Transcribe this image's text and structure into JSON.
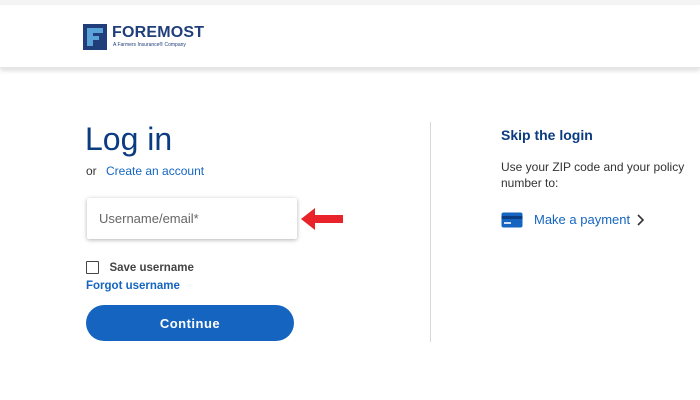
{
  "brand": {
    "name": "FOREMOST",
    "tagline": "A Farmers Insurance® Company",
    "logo_icon": "foremost-f-logo",
    "primary_color": "#1f3e7a",
    "accent_color": "#5aa3d8"
  },
  "login": {
    "title": "Log in",
    "or_text": "or",
    "create_account_link": "Create an account",
    "username_placeholder": "Username/email*",
    "username_value": "",
    "save_username_label": "Save username",
    "save_username_checked": false,
    "forgot_username_link": "Forgot username",
    "continue_button": "Continue"
  },
  "annotation": {
    "arrow_icon": "red-left-arrow-icon",
    "color": "#e8232a"
  },
  "skip": {
    "title": "Skip the login",
    "description": "Use your ZIP code and your policy number to:",
    "payment_link": "Make a payment",
    "payment_icon": "credit-card-icon",
    "chevron_icon": "chevron-right-icon"
  },
  "colors": {
    "heading": "#0b3b80",
    "link": "#1565c0",
    "button": "#1565c0"
  }
}
